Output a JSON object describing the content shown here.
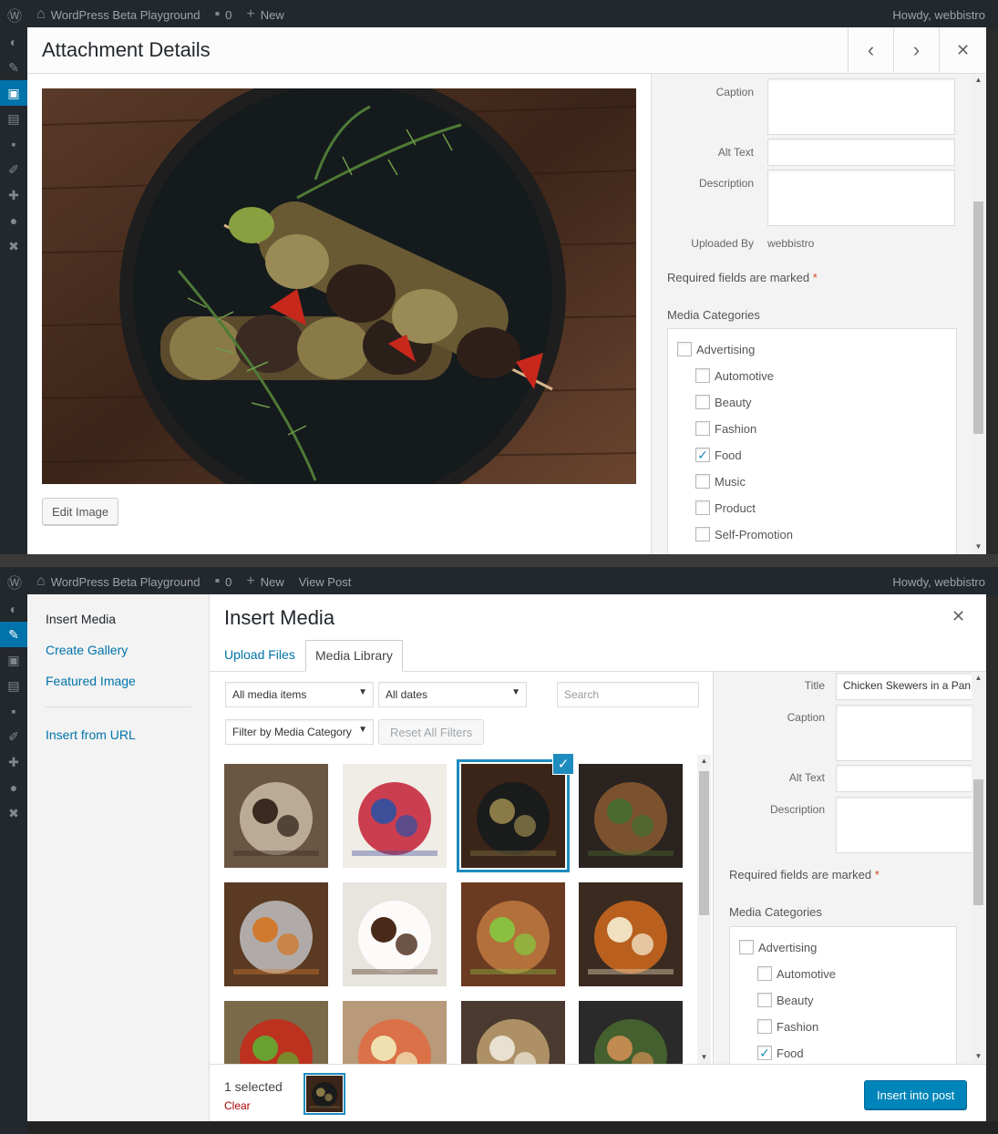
{
  "adminbar": {
    "site_name": "WordPress Beta Playground",
    "comments_count": "0",
    "new_label": "New",
    "view_post_label": "View Post",
    "howdy": "Howdy, webbistro"
  },
  "attachment_modal": {
    "title": "Attachment Details",
    "prev_icon": "chevron-left-icon",
    "next_icon": "chevron-right-icon",
    "close_icon": "close-icon",
    "edit_image_label": "Edit Image",
    "fields": {
      "caption_label": "Caption",
      "caption_value": "",
      "alt_label": "Alt Text",
      "alt_value": "",
      "description_label": "Description",
      "description_value": "",
      "uploaded_by_label": "Uploaded By",
      "uploaded_by_value": "webbistro"
    },
    "required_note": "Required fields are marked",
    "required_star": "*",
    "categories_heading": "Media Categories",
    "categories": [
      {
        "label": "Advertising",
        "checked": false,
        "level": 0
      },
      {
        "label": "Automotive",
        "checked": false,
        "level": 1
      },
      {
        "label": "Beauty",
        "checked": false,
        "level": 1
      },
      {
        "label": "Fashion",
        "checked": false,
        "level": 1
      },
      {
        "label": "Food",
        "checked": true,
        "level": 1
      },
      {
        "label": "Music",
        "checked": false,
        "level": 1
      },
      {
        "label": "Product",
        "checked": false,
        "level": 1
      },
      {
        "label": "Self-Promotion",
        "checked": false,
        "level": 1
      }
    ]
  },
  "insert_modal": {
    "title": "Insert Media",
    "menu": {
      "insert_media": "Insert Media",
      "create_gallery": "Create Gallery",
      "featured_image": "Featured Image",
      "insert_from_url": "Insert from URL"
    },
    "tabs": {
      "upload": "Upload Files",
      "library": "Media Library"
    },
    "filters": {
      "media_items": "All media items",
      "dates": "All dates",
      "search_placeholder": "Search",
      "media_category": "Filter by Media Category",
      "reset": "Reset All Filters"
    },
    "thumbnails": [
      "rolling-pin-flour",
      "berries-bowl",
      "chicken-skewers",
      "noodle-bowl",
      "cutlery",
      "coffee-cups",
      "cupcakes",
      "pickled-jars",
      "vegetables",
      "sandwich",
      "bread-board",
      "greens-spoon"
    ],
    "selected_index": 2,
    "sidebar": {
      "title_label": "Title",
      "title_value": "Chicken Skewers in a Pan",
      "caption_label": "Caption",
      "caption_value": "",
      "alt_label": "Alt Text",
      "alt_value": "",
      "description_label": "Description",
      "description_value": "",
      "required_note": "Required fields are marked",
      "required_star": "*",
      "categories_heading": "Media Categories",
      "categories": [
        {
          "label": "Advertising",
          "checked": false,
          "level": 0
        },
        {
          "label": "Automotive",
          "checked": false,
          "level": 1
        },
        {
          "label": "Beauty",
          "checked": false,
          "level": 1
        },
        {
          "label": "Fashion",
          "checked": false,
          "level": 1
        },
        {
          "label": "Food",
          "checked": true,
          "level": 1
        }
      ]
    },
    "toolbar": {
      "selected_count": "1 selected",
      "clear_label": "Clear",
      "insert_label": "Insert into post"
    }
  },
  "colors": {
    "accent": "#0073aa",
    "primary_button": "#0085ba",
    "selected_outline": "#1e8cbe",
    "required_star": "#d54e21",
    "clear_link": "#aa0000"
  }
}
